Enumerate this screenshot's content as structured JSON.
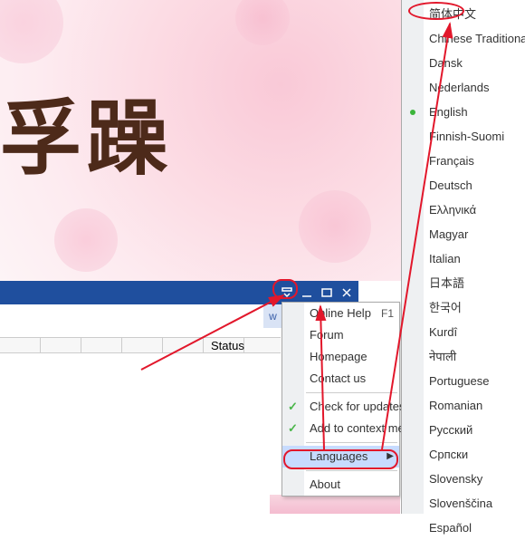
{
  "wallpaper": {
    "hanzi": "孚躁"
  },
  "titlebar": {
    "icons": [
      "dropdown",
      "minimize",
      "maximize",
      "close"
    ]
  },
  "w_strip": "w",
  "statusbar": {
    "status_label": "Status"
  },
  "menu": {
    "items": [
      {
        "label": "Online Help",
        "shortcut": "F1"
      },
      {
        "label": "Forum"
      },
      {
        "label": "Homepage"
      },
      {
        "label": "Contact us"
      }
    ],
    "block2": [
      {
        "label": "Check for updates",
        "checked": true
      },
      {
        "label": "Add to context menu",
        "checked": true
      }
    ],
    "languages_label": "Languages",
    "about_label": "About"
  },
  "languages": [
    "简体中文",
    "Chinese Traditional",
    "Dansk",
    "Nederlands",
    "English",
    "Finnish-Suomi",
    "Français",
    "Deutsch",
    "Ελληνικά",
    "Magyar",
    "Italian",
    "日本語",
    "한국어",
    "Kurdî",
    "नेपाली",
    "Portuguese",
    "Romanian",
    "Русский",
    "Српски",
    "Slovensky",
    "Slovenščina",
    "Español"
  ],
  "languages_active_index": 4
}
